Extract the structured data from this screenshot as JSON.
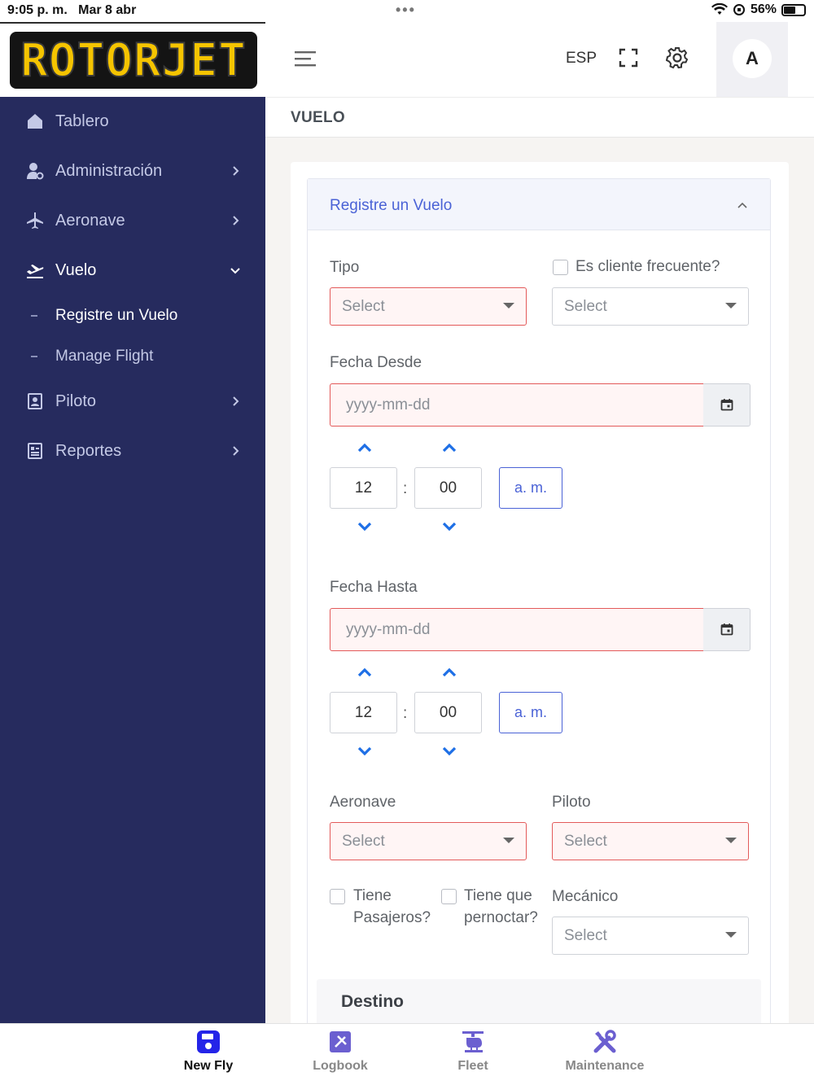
{
  "status_bar": {
    "time": "9:05 p. m.",
    "date": "Mar 8 abr",
    "battery": "56%"
  },
  "brand": {
    "logo_text": "ROTORJET"
  },
  "sidebar": {
    "items": [
      {
        "label": "Tablero"
      },
      {
        "label": "Administración"
      },
      {
        "label": "Aeronave"
      },
      {
        "label": "Vuelo"
      },
      {
        "label": "Piloto"
      },
      {
        "label": "Reportes"
      }
    ],
    "sub_items": [
      {
        "label": "Registre un Vuelo"
      },
      {
        "label": "Manage Flight"
      }
    ]
  },
  "header": {
    "language": "ESP",
    "avatar_initial": "A"
  },
  "page": {
    "title": "VUELO"
  },
  "form": {
    "section_title": "Registre un Vuelo",
    "tipo_label": "Tipo",
    "tipo_value": "Select",
    "frecuente_label": "Es cliente frecuente?",
    "frecuente_value": "Select",
    "fecha_desde_label": "Fecha Desde",
    "fecha_desde_placeholder": "yyyy-mm-dd",
    "desde_hour": "12",
    "desde_minute": "00",
    "desde_ampm": "a. m.",
    "fecha_hasta_label": "Fecha Hasta",
    "fecha_hasta_placeholder": "yyyy-mm-dd",
    "hasta_hour": "12",
    "hasta_minute": "00",
    "hasta_ampm": "a. m.",
    "aeronave_label": "Aeronave",
    "aeronave_value": "Select",
    "piloto_label": "Piloto",
    "piloto_value": "Select",
    "pasajeros_label_1": "Tiene",
    "pasajeros_label_2": "Pasajeros?",
    "pernoctar_label_1": "Tiene que",
    "pernoctar_label_2": "pernoctar?",
    "mecanico_label": "Mecánico",
    "mecanico_value": "Select",
    "destino_title": "Destino",
    "colon": ":"
  },
  "tabbar": {
    "tabs": [
      {
        "label": "New Fly"
      },
      {
        "label": "Logbook"
      },
      {
        "label": "Fleet"
      },
      {
        "label": "Maintenance"
      }
    ]
  },
  "colors": {
    "sidebar": "#262b5e",
    "accent": "#4a62d6",
    "error": "#e35a5a",
    "tab_icon": "#6b5fd0"
  }
}
